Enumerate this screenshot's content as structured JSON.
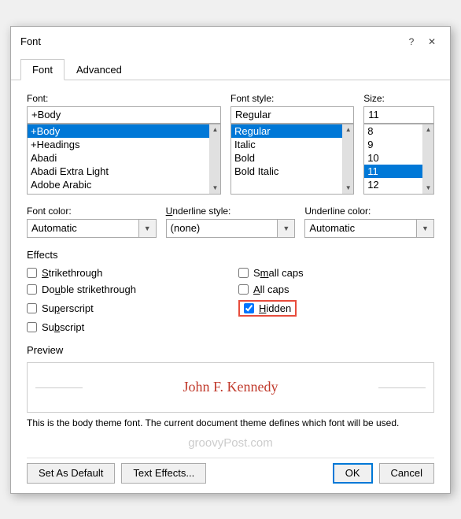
{
  "dialog": {
    "title": "Font",
    "help_btn": "?",
    "close_btn": "✕"
  },
  "tabs": [
    {
      "label": "Font",
      "active": true
    },
    {
      "label": "Advanced",
      "active": false
    }
  ],
  "font_section": {
    "font_label": "Font:",
    "font_value": "+Body",
    "font_items": [
      "+Body",
      "+Headings",
      "Abadi",
      "Abadi Extra Light",
      "Adobe Arabic"
    ],
    "font_selected": "+Body",
    "style_label": "Font style:",
    "style_value": "Regular",
    "style_items": [
      "Regular",
      "Italic",
      "Bold",
      "Bold Italic"
    ],
    "style_selected": "Regular",
    "size_label": "Size:",
    "size_value": "11",
    "size_items": [
      "8",
      "9",
      "10",
      "11",
      "12"
    ],
    "size_selected": "11"
  },
  "dropdowns": {
    "font_color_label": "Font color:",
    "font_color_value": "Automatic",
    "underline_style_label": "Underline style:",
    "underline_style_value": "(none)",
    "underline_color_label": "Underline color:",
    "underline_color_value": "Automatic"
  },
  "effects": {
    "section_label": "Effects",
    "strikethrough_label": "Strikethrough",
    "strikethrough_checked": false,
    "double_strikethrough_label": "Double strikethrough",
    "double_strikethrough_checked": false,
    "superscript_label": "Superscript",
    "superscript_checked": false,
    "subscript_label": "Subscript",
    "subscript_checked": false,
    "small_caps_label": "Small caps",
    "small_caps_checked": false,
    "all_caps_label": "All caps",
    "all_caps_checked": false,
    "hidden_label": "Hidden",
    "hidden_checked": true
  },
  "preview": {
    "section_label": "Preview",
    "preview_text": "John F. Kennedy",
    "caption": "This is the body theme font. The current document theme defines which font will be used."
  },
  "watermark": {
    "text": "groovyPost.com"
  },
  "buttons": {
    "set_as_default": "Set As Default",
    "text_effects": "Text Effects...",
    "ok": "OK",
    "cancel": "Cancel"
  }
}
